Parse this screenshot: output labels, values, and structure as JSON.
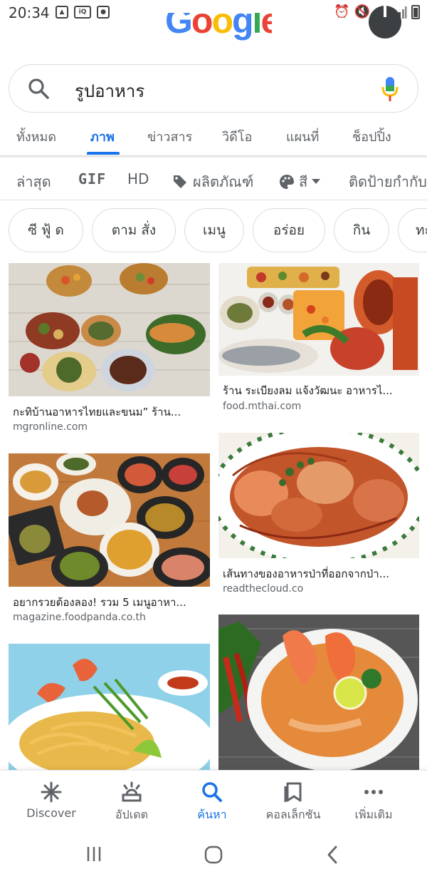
{
  "status_bar": {
    "time": "20:34",
    "left_icons": [
      "image-icon",
      "iqiyi-icon",
      "media-icon"
    ],
    "right_icons": [
      "alarm-icon",
      "mute-icon",
      "wifi-icon",
      "signal-icon",
      "battery-icon"
    ]
  },
  "header": {
    "logo_text": "Google",
    "avatar": "profile-avatar"
  },
  "search": {
    "query": "รูปอาหาร"
  },
  "tabs": [
    {
      "label": "ทั้งหมด",
      "active": false
    },
    {
      "label": "ภาพ",
      "active": true
    },
    {
      "label": "ข่าวสาร",
      "active": false
    },
    {
      "label": "วิดีโอ",
      "active": false
    },
    {
      "label": "แผนที่",
      "active": false
    },
    {
      "label": "ช็อปปิ้ง",
      "active": false
    }
  ],
  "filters": {
    "latest": "ล่าสุด",
    "gif": "GIF",
    "hd": "HD",
    "products": "ผลิตภัณฑ์",
    "color": "สี",
    "tagged": "ติดป้ายกำกับ"
  },
  "chips": [
    "ซี ฟู้ ด",
    "ตาม สั่ง",
    "เมนู",
    "อร่อย",
    "กิน",
    "ทะ"
  ],
  "results": [
    {
      "title": "กะทิบ้านอาหารไทยและขนม” ร้าน...",
      "source": "mgronline.com"
    },
    {
      "title": "ร้าน ระเบียงลม แจ้งวัฒนะ อาหารไ...",
      "source": "food.mthai.com"
    },
    {
      "title": "อยากรวยต้องลอง! รวม 5 เมนูอาหา...",
      "source": "magazine.foodpanda.co.th"
    },
    {
      "title": "เส้นทางของอาหารป่าที่ออกจากป่า...",
      "source": "readthecloud.co"
    }
  ],
  "bottom_nav": [
    {
      "label": "Discover",
      "icon": "asterisk-icon",
      "active": false
    },
    {
      "label": "อัปเดต",
      "icon": "updates-icon",
      "active": false
    },
    {
      "label": "ค้นหา",
      "icon": "search-icon",
      "active": true
    },
    {
      "label": "คอลเล็กชัน",
      "icon": "collections-icon",
      "active": false
    },
    {
      "label": "เพิ่มเติม",
      "icon": "more-icon",
      "active": false
    }
  ],
  "colors": {
    "accent": "#1a73e8",
    "text": "#202124",
    "muted": "#5f6368"
  }
}
